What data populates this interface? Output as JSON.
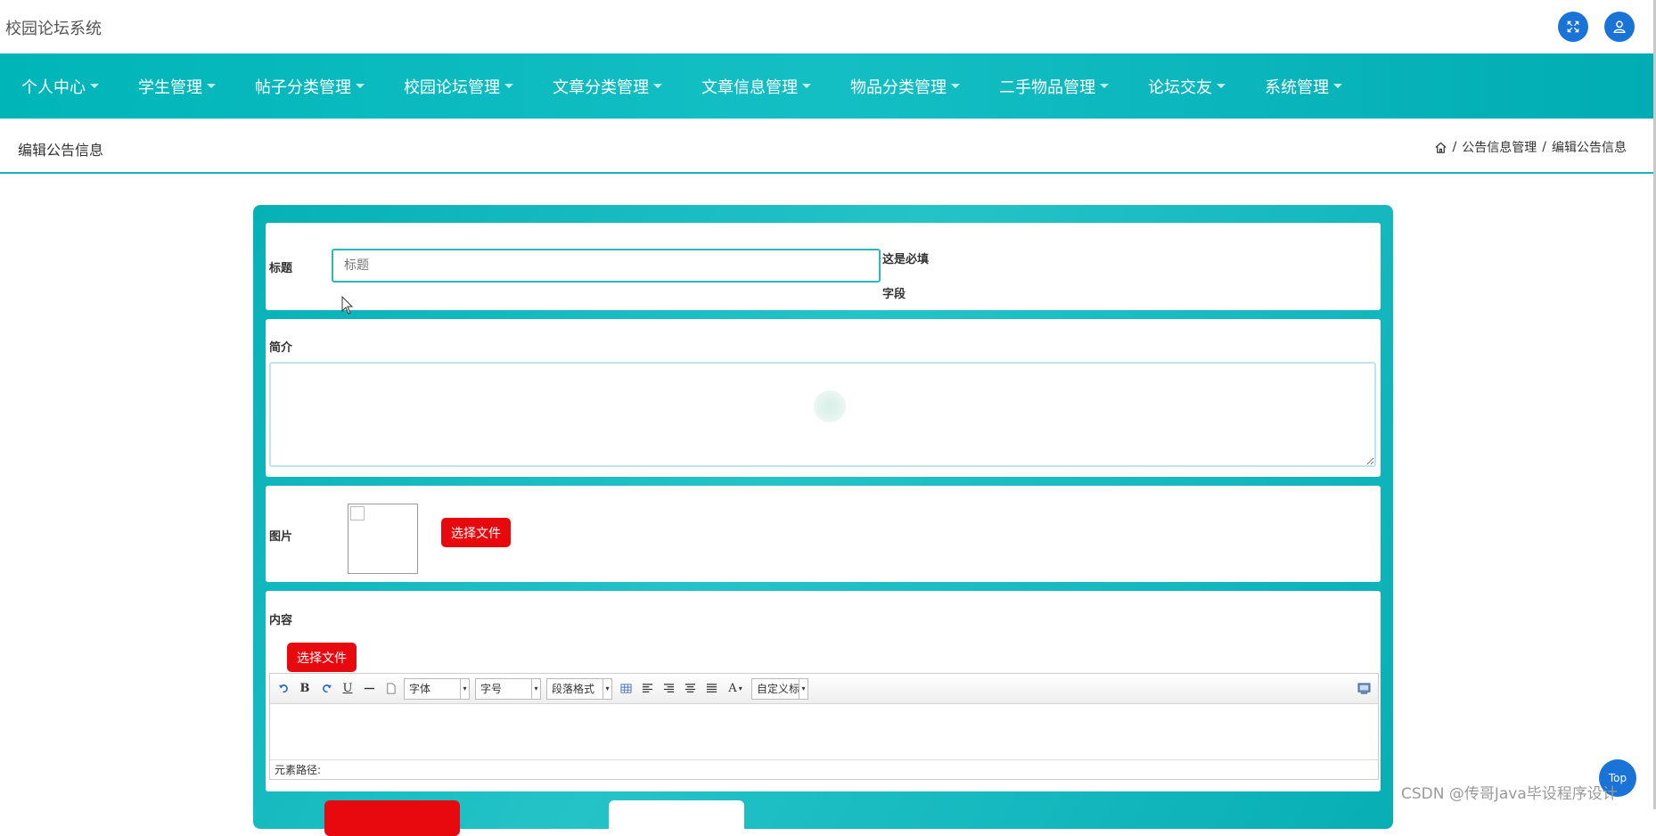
{
  "app": {
    "title": "校园论坛系统"
  },
  "header_icons": [
    "fullscreen-icon",
    "user-icon"
  ],
  "nav": {
    "items": [
      {
        "label": "个人中心"
      },
      {
        "label": "学生管理"
      },
      {
        "label": "帖子分类管理"
      },
      {
        "label": "校园论坛管理"
      },
      {
        "label": "文章分类管理"
      },
      {
        "label": "文章信息管理"
      },
      {
        "label": "物品分类管理"
      },
      {
        "label": "二手物品管理"
      },
      {
        "label": "论坛交友"
      },
      {
        "label": "系统管理"
      }
    ]
  },
  "page": {
    "title": "编辑公告信息",
    "breadcrumb": {
      "section": "公告信息管理",
      "sep": "/",
      "current": "编辑公告信息"
    }
  },
  "form": {
    "title_label": "标题",
    "title_placeholder": "标题",
    "title_required_hint": "这是必填字段",
    "intro_label": "简介",
    "image_label": "图片",
    "choose_file_label": "选择文件",
    "content_label": "内容",
    "content_choose_file_label": "选择文件"
  },
  "editor": {
    "font_select": "字体",
    "size_select": "字号",
    "paragraph_select": "段落格式",
    "custom_title_select": "自定义标题",
    "status_path": "元素路径:"
  },
  "top_button": {
    "label": "Top"
  },
  "watermark": "CSDN @传哥Java毕设程序设计",
  "colors": {
    "teal": "#00b5b8",
    "red": "#e8090f",
    "blue": "#1a73d6"
  }
}
